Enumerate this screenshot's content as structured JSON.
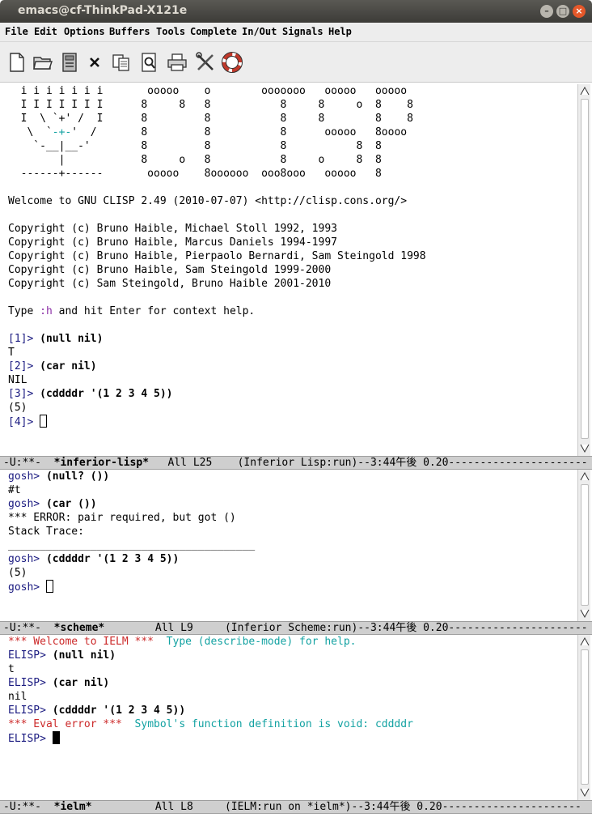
{
  "window": {
    "title": "emacs@cf-ThinkPad-X121e"
  },
  "menu": [
    "File",
    "Edit",
    "Options",
    "Buffers",
    "Tools",
    "Complete",
    "In/Out",
    "Signals",
    "Help"
  ],
  "toolbar": [
    "new-file",
    "open-folder",
    "save",
    "close",
    "copy",
    "find",
    "print",
    "preferences",
    "help"
  ],
  "lisp": {
    "banner": [
      "  i i i i i i i       ooooo    o        ooooooo   ooooo   ooooo",
      "  I I I I I I I      8     8   8           8     8     o  8    8",
      "  I  \\ `+' /  I      8         8           8     8        8    8",
      "   \\  `-+-'  /       8         8           8      ooooo   8oooo",
      "    `-__|__-'        8         8           8           8  8",
      "        |            8     o   8           8     o     8  8",
      "  ------+------       ooooo    8oooooo  ooo8ooo   ooooo   8"
    ],
    "welcome": "Welcome to GNU CLISP 2.49 (2010-07-07) <http://clisp.cons.org/>",
    "copyright": [
      "Copyright (c) Bruno Haible, Michael Stoll 1992, 1993",
      "Copyright (c) Bruno Haible, Marcus Daniels 1994-1997",
      "Copyright (c) Bruno Haible, Pierpaolo Bernardi, Sam Steingold 1998",
      "Copyright (c) Bruno Haible, Sam Steingold 1999-2000",
      "Copyright (c) Sam Steingold, Bruno Haible 2001-2010"
    ],
    "help_pre": "Type ",
    "help_cmd": ":h",
    "help_post": " and hit Enter for context help.",
    "p1": "[1]> ",
    "c1": "(null nil)",
    "o1": "T",
    "p2": "[2]> ",
    "c2": "(car nil)",
    "o2": "NIL",
    "p3": "[3]> ",
    "c3": "(cddddr '(1 2 3 4 5))",
    "o3": "(5)",
    "p4": "[4]> "
  },
  "modeline1": {
    "pre": "-U:**-  ",
    "buffer": "*inferior-lisp*",
    "post": "   All L25    (Inferior Lisp:run)--3:44午後 0.20----------------------"
  },
  "scheme": {
    "p1": "gosh> ",
    "c1": "(null? ())",
    "o1": "#t",
    "p2": "gosh> ",
    "c2": "(car ())",
    "err": "*** ERROR: pair required, but got ()",
    "trace": "Stack Trace:",
    "sep": "_______________________________________",
    "p3": "gosh> ",
    "c3": "(cddddr '(1 2 3 4 5))",
    "o3": "(5)",
    "p4": "gosh> "
  },
  "modeline2": {
    "pre": "-U:**-  ",
    "buffer": "*scheme*",
    "post": "        All L9     (Inferior Scheme:run)--3:44午後 0.20----------------------"
  },
  "ielm": {
    "welcome_red": "*** Welcome to IELM ***",
    "welcome_cyan": "  Type (describe-mode) for help.",
    "p1": "ELISP> ",
    "c1": "(null nil)",
    "o1": "t",
    "p2": "ELISP> ",
    "c2": "(car nil)",
    "o2": "nil",
    "p3": "ELISP> ",
    "c3": "(cddddr '(1 2 3 4 5))",
    "err_red": "*** Eval error ***",
    "err_cyan": "  Symbol's function definition is void: cddddr",
    "p4": "ELISP> "
  },
  "modeline3": {
    "pre": "-U:**-  ",
    "buffer": "*ielm*",
    "post": "          All L8     (IELM:run on *ielm*)--3:44午後 0.20----------------------"
  }
}
